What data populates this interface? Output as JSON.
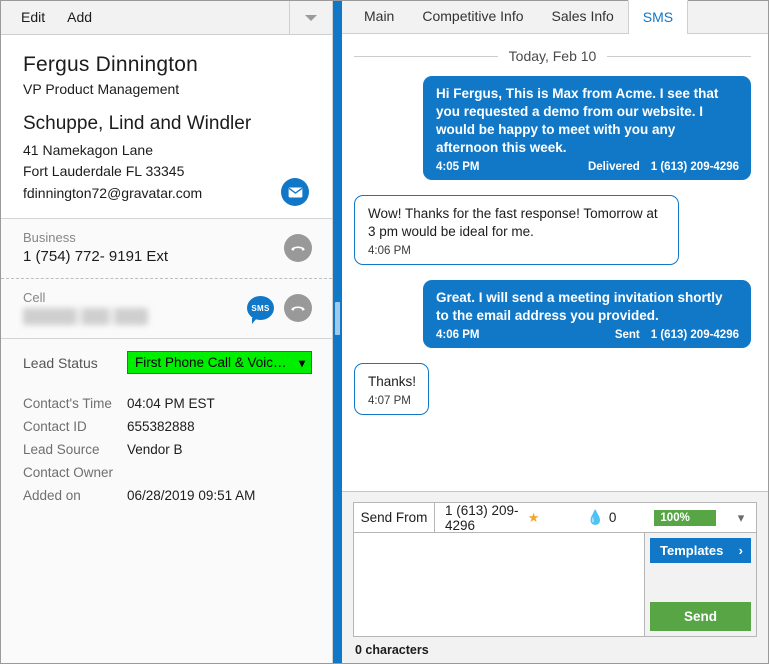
{
  "left_panel": {
    "menu": {
      "items": [
        "Edit",
        "Add"
      ],
      "caret_icon": "chevron-down-icon"
    },
    "contact": {
      "name": "Fergus  Dinnington",
      "title": "VP Product Management",
      "company": "Schuppe, Lind and Windler",
      "address_line1": "41 Namekagon Lane",
      "address_line2": "Fort Lauderdale  FL  33345",
      "email": "fdinnington72@gravatar.com",
      "email_icon": "envelope-icon"
    },
    "phones": [
      {
        "label": "Business",
        "number": "1 (754) 772- 9191   Ext",
        "redacted": false,
        "has_sms": false,
        "call_icon": "phone-handset-icon"
      },
      {
        "label": "Cell",
        "number": "",
        "redacted": true,
        "has_sms": true,
        "sms_icon": "sms-bubble-icon",
        "sms_icon_label": "SMS",
        "call_icon": "phone-handset-icon"
      }
    ],
    "lead_status": {
      "label": "Lead Status",
      "value": "First Phone Call & Voic…",
      "background_color": "#00ee00",
      "caret_icon": "chevron-down-icon"
    },
    "details": [
      {
        "key": "Contact's Time",
        "value": "04:04 PM EST"
      },
      {
        "key": "Contact ID",
        "value": "655382888"
      },
      {
        "key": "Lead Source",
        "value": "Vendor B"
      },
      {
        "key": "Contact Owner",
        "value": ""
      },
      {
        "key": "Added on",
        "value": "06/28/2019 09:51 AM"
      }
    ]
  },
  "right_panel": {
    "tabs": [
      {
        "label": "Main",
        "active": false
      },
      {
        "label": "Competitive Info",
        "active": false
      },
      {
        "label": "Sales Info",
        "active": false
      },
      {
        "label": "SMS",
        "active": true
      }
    ],
    "date_divider": "Today, Feb 10",
    "messages": [
      {
        "direction": "out",
        "body": "Hi Fergus, This is Max from Acme. I see that you requested a demo from our website. I would be happy to meet with you any afternoon this week.",
        "time": "4:05 PM",
        "status": "Delivered",
        "from": "1 (613) 209-4296"
      },
      {
        "direction": "in",
        "body": "Wow! Thanks for the fast response! Tomorrow at 3 pm would be ideal for me.",
        "time": "4:06 PM",
        "status": "",
        "from": ""
      },
      {
        "direction": "out",
        "body": "Great. I will send a meeting invitation shortly to the email address you provided.",
        "time": "4:06 PM",
        "status": "Sent",
        "from": "1 (613) 209-4296"
      },
      {
        "direction": "in",
        "body": "Thanks!",
        "time": "4:07 PM",
        "status": "",
        "from": ""
      }
    ],
    "composer": {
      "send_from_label": "Send From",
      "send_from_number": "1 (613) 209-4296",
      "favorite_icon": "star-icon",
      "drop_icon": "water-drop-icon",
      "drop_count": "0",
      "percent_badge": "100%",
      "percent_color": "#57a544",
      "caret_icon": "chevron-down-icon",
      "message_value": "",
      "message_placeholder": "",
      "templates_label": "Templates",
      "templates_caret_icon": "chevron-right-icon",
      "send_label": "Send",
      "char_count": "0 characters"
    }
  }
}
